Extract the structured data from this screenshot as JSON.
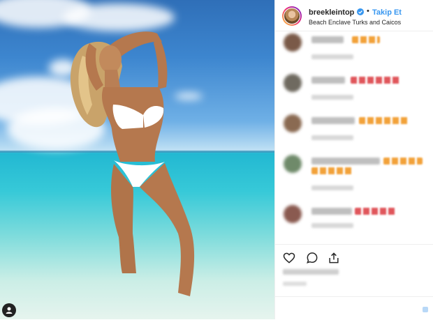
{
  "post": {
    "username": "breekleintop",
    "verified": true,
    "separator": "•",
    "follow_label": "Takip Et",
    "location": "Beach Enclave Turks and Caicos"
  },
  "comments": [
    {
      "name": "blurred-comment-1",
      "emoji_color": "orange",
      "avatar_color": "#7a5a48"
    },
    {
      "name": "blurred-comment-2",
      "emoji_color": "red",
      "avatar_color": "#6f6a60"
    },
    {
      "name": "blurred-comment-3",
      "emoji_color": "orange",
      "avatar_color": "#8a6a52"
    },
    {
      "name": "blurred-comment-4",
      "emoji_color": "orange",
      "avatar_color": "#6f8a6a"
    },
    {
      "name": "blurred-comment-5",
      "emoji_color": "red",
      "avatar_color": "#8a5a50"
    }
  ],
  "actions": {
    "icons": [
      "heart-icon",
      "comment-icon",
      "share-icon"
    ]
  },
  "colors": {
    "accent": "#3897f0",
    "text": "#262626",
    "border": "#efefef"
  }
}
